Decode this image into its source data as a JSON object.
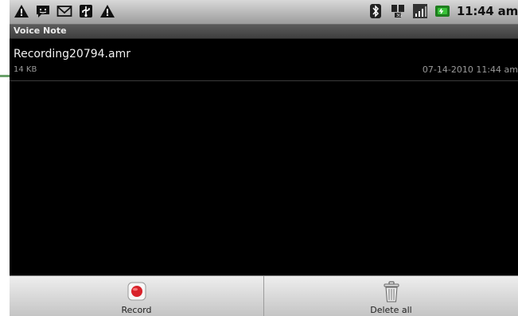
{
  "status_bar": {
    "left_icons": [
      "warning-icon",
      "message-icon",
      "gmail-icon",
      "usb-icon",
      "warning-icon"
    ],
    "right_icons": [
      "bluetooth-icon",
      "network-icon",
      "signal-icon",
      "battery-icon"
    ],
    "time": "11:44 am"
  },
  "app": {
    "title": "Voice Note"
  },
  "recordings": [
    {
      "name": "Recording20794.amr",
      "size": "14 KB",
      "date": "07-14-2010 11:44 am"
    }
  ],
  "bottom_bar": {
    "record_label": "Record",
    "record_icon": "record-icon",
    "delete_all_label": "Delete all",
    "delete_all_icon": "trash-icon"
  },
  "colors": {
    "background": "#000000",
    "status_bar": "#b9b9b9",
    "title_bar": "#4a4a4a",
    "record_red": "#d8222a",
    "marker_green": "#6aa06a"
  }
}
